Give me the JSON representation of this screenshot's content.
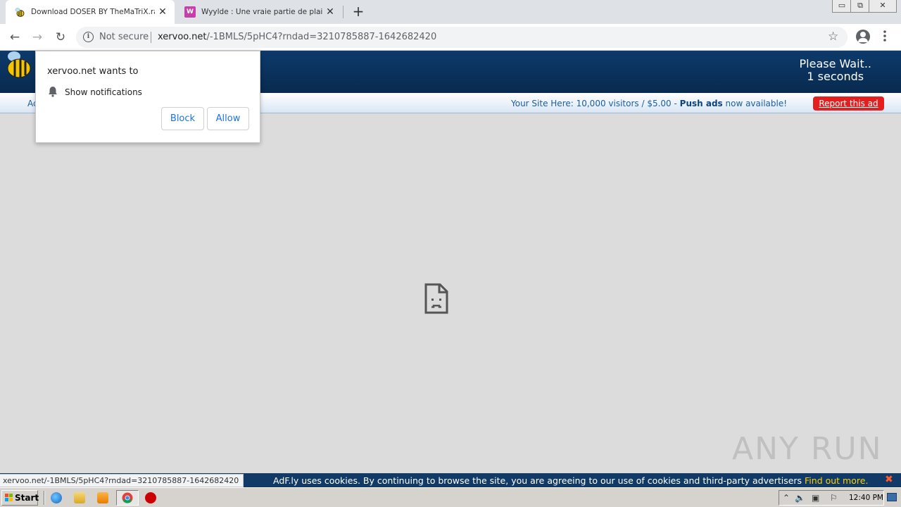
{
  "browser": {
    "tabs": [
      {
        "title": "Download DOSER BY TheMaTriX.rar",
        "close": "✕",
        "favicon": "bee-favicon"
      },
      {
        "title": "Wyylde : Une vraie partie de plaisir",
        "close": "✕",
        "favicon": "w-favicon",
        "favicon_letter": "W"
      }
    ],
    "new_tab": "+",
    "window_controls": [
      "▭",
      "⧉",
      "✕"
    ],
    "address": {
      "security_label": "Not secure",
      "host": "xervoo.net",
      "path": "/-1BMLS/5pHC4?rndad=3210785887-1642682420"
    },
    "icons": {
      "back": "←",
      "forward": "→",
      "reload": "↻",
      "info": "i",
      "star": "☆"
    }
  },
  "page": {
    "countdown_line1": "Please Wait..",
    "countdown_line2": "1 seconds",
    "adbar_left": "Ac",
    "adbar_prefix": "Your Site Here: 10,000 visitors / $5.00 - ",
    "adbar_bold": "Push ads",
    "adbar_suffix": " now available!",
    "report_label": "Report this ad"
  },
  "permission_prompt": {
    "title": "xervoo.net wants to",
    "permission": "Show notifications",
    "block_label": "Block",
    "allow_label": "Allow"
  },
  "status_url": "xervoo.net/-1BMLS/5pHC4?rndad=3210785887-1642682420",
  "cookie_bar": {
    "text": "AdF.ly uses cookies. By continuing to browse the site, you are agreeing to our use of cookies and third-party advertisers ",
    "link": "Find out more.",
    "close": "✖"
  },
  "watermark": "ANY RUN",
  "taskbar": {
    "start_label": "Start",
    "clock": "12:40 PM",
    "tray_icons": [
      "up-arrow-icon",
      "volume-icon",
      "network-icon",
      "flag-icon"
    ]
  },
  "colors": {
    "header_bg": "#0d3a6b",
    "report_bg": "#e32020",
    "cookie_link": "#ffd200",
    "allow_text": "#1a73e8"
  }
}
